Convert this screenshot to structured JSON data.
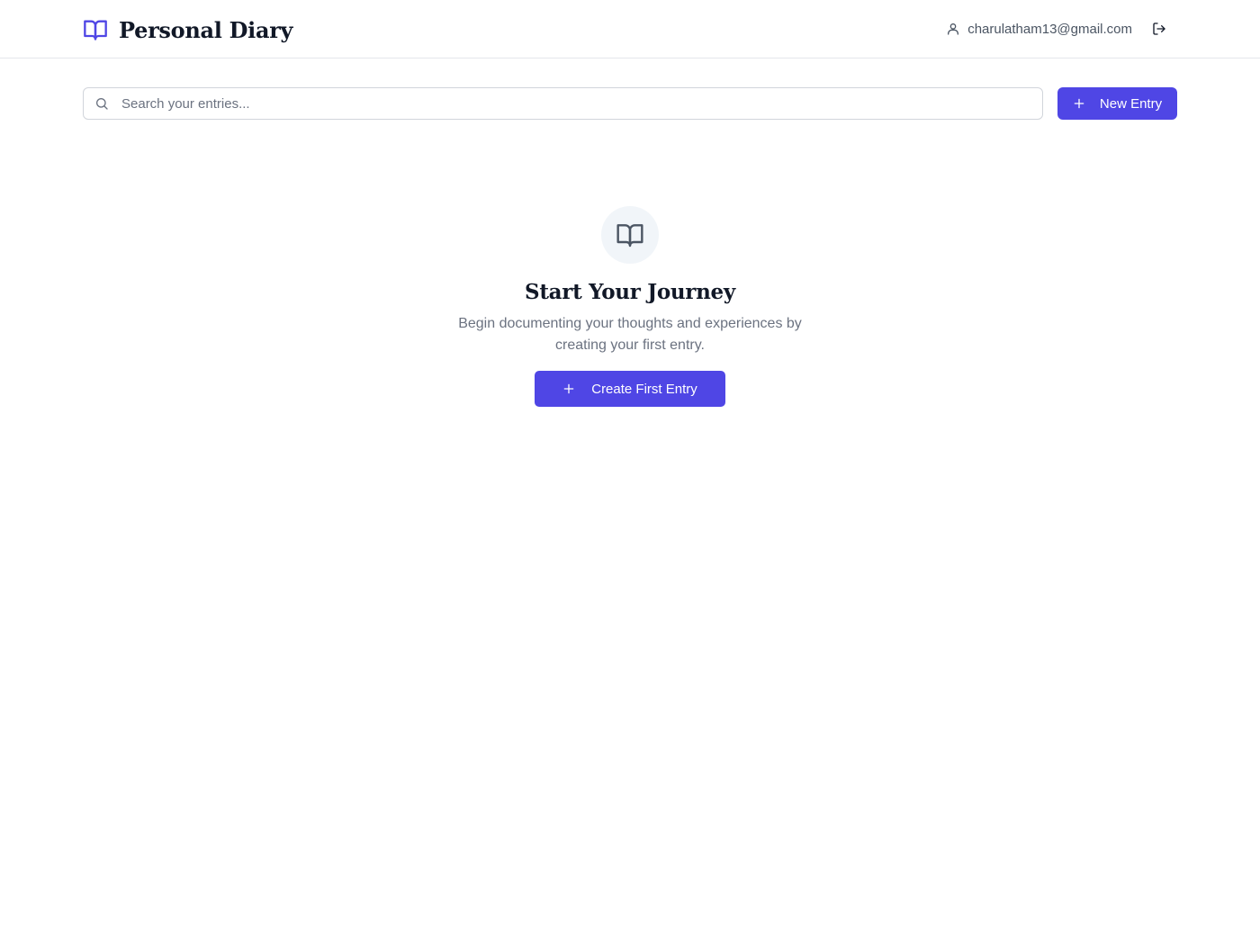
{
  "header": {
    "brand_icon": "book-open-icon",
    "title": "Personal Diary",
    "user_icon": "user-icon",
    "user_email": "charulatham13@gmail.com",
    "logout_icon": "logout-icon"
  },
  "toolbar": {
    "search_icon": "search-icon",
    "search_placeholder": "Search your entries...",
    "search_value": "",
    "new_entry_icon": "plus-icon",
    "new_entry_label": "New Entry"
  },
  "empty_state": {
    "icon": "book-open-icon",
    "title": "Start Your Journey",
    "description": "Begin documenting your thoughts and experiences by creating your first entry.",
    "button_icon": "plus-icon",
    "button_label": "Create First Entry"
  },
  "colors": {
    "accent": "#4f46e5",
    "border": "#e5e7eb",
    "muted_text": "#6b7280",
    "icon_circle_bg": "#f1f5f9"
  }
}
